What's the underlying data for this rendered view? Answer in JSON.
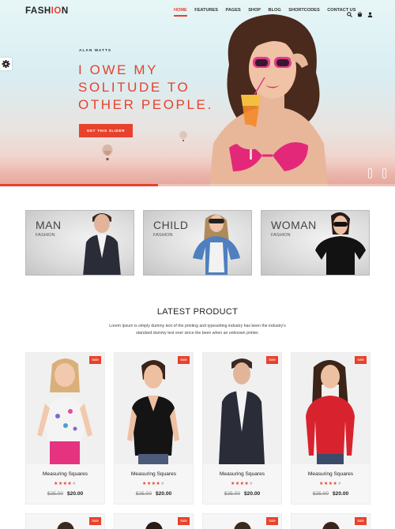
{
  "header": {
    "logo_part1": "FASH",
    "logo_part2": "IO",
    "logo_part3": "N",
    "nav": [
      "HOME",
      "FEATURES",
      "PAGES",
      "SHOP",
      "BLOG",
      "SHORTCODES",
      "CONTACT US"
    ],
    "active_nav": "HOME",
    "icons": [
      "search-icon",
      "cart-icon",
      "user-icon"
    ]
  },
  "hero": {
    "subtitle": "ALAN WATTS",
    "title_lines": [
      "I OWE MY",
      "SOLITUDE TO",
      "OTHER PEOPLE."
    ],
    "button_label": "GET THIS SLIDER",
    "slide_progress": 0.4,
    "accent_color": "#e8412c"
  },
  "categories": [
    {
      "title": "MAN",
      "subtitle": "FASHION"
    },
    {
      "title": "CHILD",
      "subtitle": "FASHION"
    },
    {
      "title": "WOMAN",
      "subtitle": "FASHION"
    }
  ],
  "latest": {
    "title": "LATEST PRODUCT",
    "description": "Lorem Ipsum is simply dummy text of the printing and typesetting industry has been the industry's standard dummy text ever since the been when an unknown printer."
  },
  "products": [
    {
      "badge": "Sale",
      "name": "Measuring Squares",
      "rating": 4,
      "old_price": "$25.00",
      "price": "$20.00"
    },
    {
      "badge": "Sale",
      "name": "Measuring Squares",
      "rating": 4,
      "old_price": "$25.00",
      "price": "$20.00"
    },
    {
      "badge": "Sale",
      "name": "Measuring Squares",
      "rating": 4,
      "old_price": "$25.00",
      "price": "$20.00"
    },
    {
      "badge": "Sale",
      "name": "Measuring Squares",
      "rating": 4,
      "old_price": "$25.00",
      "price": "$20.00"
    }
  ],
  "products_row2": [
    {
      "badge": "Sale"
    },
    {
      "badge": "Sale"
    },
    {
      "badge": "Sale"
    },
    {
      "badge": "Sale"
    }
  ]
}
